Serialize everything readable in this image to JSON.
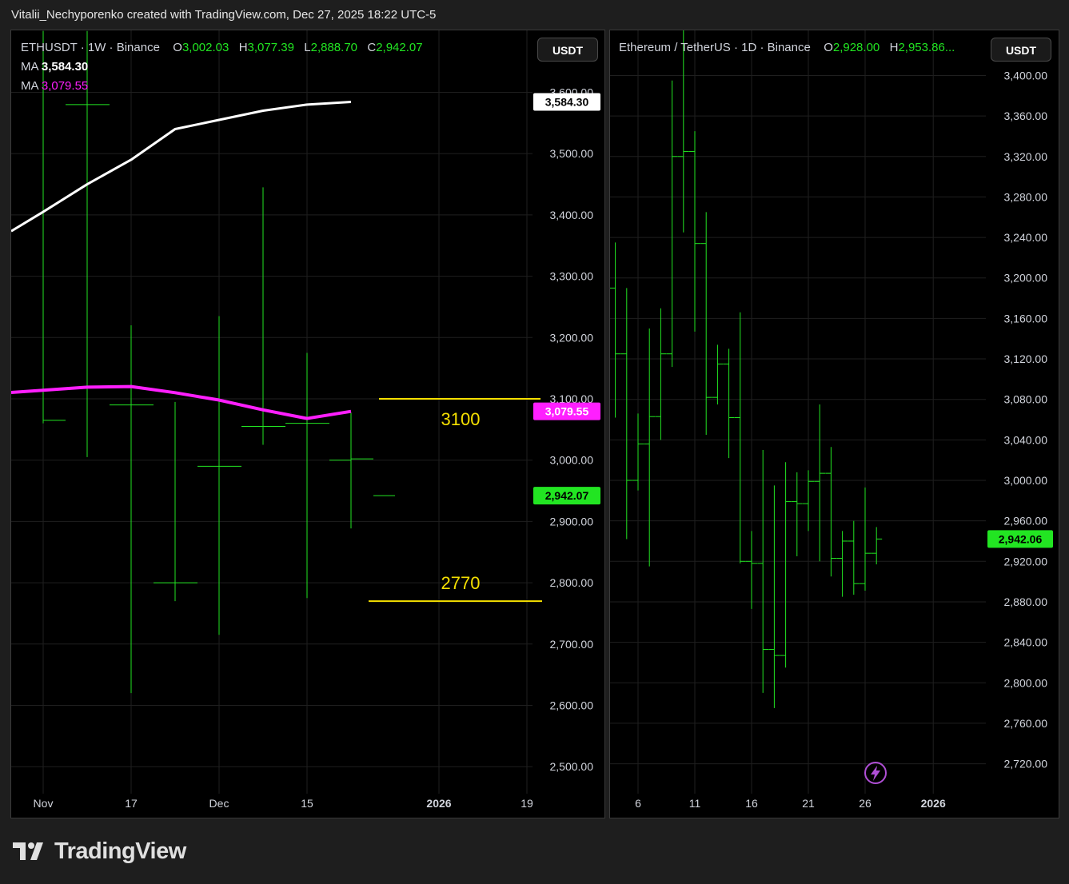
{
  "header": {
    "attribution": "Vitalii_Nechyporenko created with TradingView.com, Dec 27, 2025 18:22 UTC-5"
  },
  "brand": {
    "logo_icon": "tradingview-logo-icon",
    "name": "TradingView"
  },
  "colors": {
    "up": "#22e522",
    "ma_long": "#ffffff",
    "ma_short": "#ff1fff",
    "level": "#f5e000",
    "grid": "#1f1f1f",
    "axis_text": "#d1d4dc"
  },
  "left_panel": {
    "legend": {
      "symbol": "ETHUSDT · 1W · Binance",
      "o_label": "O",
      "o_value": "3,002.03",
      "h_label": "H",
      "h_value": "3,077.39",
      "l_label": "L",
      "l_value": "2,888.70",
      "c_label": "C",
      "c_value": "2,942.07",
      "ma1_label": "MA",
      "ma1_value": "3,584.30",
      "ma2_label": "MA",
      "ma2_value": "3,079.55"
    },
    "unit_button": "USDT",
    "annotations": {
      "level_high_text": "3100",
      "level_low_text": "2770"
    },
    "price_tags": {
      "ma1": "3,584.30",
      "ma2": "3,079.55",
      "last": "2,942.07"
    }
  },
  "right_panel": {
    "legend": {
      "symbol": "Ethereum / TetherUS · 1D · Binance",
      "o_label": "O",
      "o_value": "2,928.00",
      "h_label": "H",
      "h_value": "2,953.86..."
    },
    "unit_button": "USDT",
    "price_tag": "2,942.06",
    "bottom_icon": "lightning-icon"
  },
  "chart_data": [
    {
      "type": "ohlc",
      "title": "ETHUSDT · 1W · Binance",
      "x_tick_labels": [
        "Nov",
        "17",
        "Dec",
        "15",
        "2026",
        "19"
      ],
      "y_tick_labels": [
        "3,600.00",
        "3,500.00",
        "3,400.00",
        "3,300.00",
        "3,200.00",
        "3,100.00",
        "3,000.00",
        "2,900.00",
        "2,800.00",
        "2,700.00",
        "2,600.00",
        "2,500.00"
      ],
      "ylim": [
        2460,
        3700
      ],
      "grid": true,
      "bars": [
        {
          "date": "2025-11-03",
          "o": 3065,
          "h": 3700,
          "l": 3060,
          "c": 3580
        },
        {
          "date": "2025-11-10",
          "o": 3580,
          "h": 3700,
          "l": 3005,
          "c": 3090
        },
        {
          "date": "2025-11-17",
          "o": 3090,
          "h": 3220,
          "l": 2620,
          "c": 2800
        },
        {
          "date": "2025-11-24",
          "o": 2800,
          "h": 3095,
          "l": 2770,
          "c": 2990
        },
        {
          "date": "2025-12-01",
          "o": 2990,
          "h": 3235,
          "l": 2715,
          "c": 3055
        },
        {
          "date": "2025-12-08",
          "o": 3055,
          "h": 3445,
          "l": 3025,
          "c": 3060
        },
        {
          "date": "2025-12-15",
          "o": 3060,
          "h": 3175,
          "l": 2775,
          "c": 3000
        },
        {
          "date": "2025-12-22",
          "o": 3002.03,
          "h": 3077.39,
          "l": 2888.7,
          "c": 2942.07
        }
      ],
      "series": [
        {
          "name": "MA",
          "color": "#ffffff",
          "values": [
            3405,
            3450,
            3490,
            3540,
            3555,
            3570,
            3580,
            3584.3
          ]
        },
        {
          "name": "MA",
          "color": "#ff1fff",
          "values": [
            3114,
            3119,
            3120,
            3110,
            3098,
            3082,
            3068,
            3079.55
          ]
        }
      ],
      "horizontal_levels": [
        {
          "value": 3100,
          "label": "3100",
          "color": "#f5e000"
        },
        {
          "value": 2770,
          "label": "2770",
          "color": "#f5e000"
        }
      ]
    },
    {
      "type": "ohlc",
      "title": "Ethereum / TetherUS · 1D · Binance",
      "x_tick_labels": [
        "6",
        "11",
        "16",
        "21",
        "26",
        "2026"
      ],
      "y_tick_labels": [
        "3,400.00",
        "3,360.00",
        "3,320.00",
        "3,280.00",
        "3,240.00",
        "3,200.00",
        "3,160.00",
        "3,120.00",
        "3,080.00",
        "3,040.00",
        "3,000.00",
        "2,960.00",
        "2,920.00",
        "2,880.00",
        "2,840.00",
        "2,800.00",
        "2,760.00",
        "2,720.00"
      ],
      "ylim": [
        2700,
        3420
      ],
      "grid": true,
      "bars": [
        {
          "day": 4,
          "o": 3190,
          "h": 3235,
          "l": 3062,
          "c": 3125
        },
        {
          "day": 5,
          "o": 3125,
          "h": 3190,
          "l": 2942,
          "c": 3000
        },
        {
          "day": 6,
          "o": 3000,
          "h": 3066,
          "l": 2990,
          "c": 3036
        },
        {
          "day": 7,
          "o": 3036,
          "h": 3150,
          "l": 2915,
          "c": 3063
        },
        {
          "day": 8,
          "o": 3063,
          "h": 3170,
          "l": 3040,
          "c": 3125
        },
        {
          "day": 9,
          "o": 3125,
          "h": 3395,
          "l": 3112,
          "c": 3320
        },
        {
          "day": 10,
          "o": 3320,
          "h": 3470,
          "l": 3245,
          "c": 3325
        },
        {
          "day": 11,
          "o": 3325,
          "h": 3345,
          "l": 3147,
          "c": 3234
        },
        {
          "day": 12,
          "o": 3234,
          "h": 3265,
          "l": 3045,
          "c": 3082
        },
        {
          "day": 13,
          "o": 3082,
          "h": 3134,
          "l": 3075,
          "c": 3115
        },
        {
          "day": 14,
          "o": 3115,
          "h": 3130,
          "l": 3022,
          "c": 3062
        },
        {
          "day": 15,
          "o": 3062,
          "h": 3166,
          "l": 2918,
          "c": 2920
        },
        {
          "day": 16,
          "o": 2920,
          "h": 2950,
          "l": 2873,
          "c": 2918
        },
        {
          "day": 17,
          "o": 2918,
          "h": 3030,
          "l": 2790,
          "c": 2833
        },
        {
          "day": 18,
          "o": 2833,
          "h": 2995,
          "l": 2775,
          "c": 2827
        },
        {
          "day": 19,
          "o": 2827,
          "h": 3018,
          "l": 2815,
          "c": 2979
        },
        {
          "day": 20,
          "o": 2979,
          "h": 3008,
          "l": 2925,
          "c": 2977
        },
        {
          "day": 21,
          "o": 2977,
          "h": 3010,
          "l": 2950,
          "c": 2999
        },
        {
          "day": 22,
          "o": 2999,
          "h": 3075,
          "l": 2920,
          "c": 3007
        },
        {
          "day": 23,
          "o": 3007,
          "h": 3033,
          "l": 2905,
          "c": 2923
        },
        {
          "day": 24,
          "o": 2923,
          "h": 2950,
          "l": 2885,
          "c": 2940
        },
        {
          "day": 25,
          "o": 2940,
          "h": 2960,
          "l": 2887,
          "c": 2898
        },
        {
          "day": 26,
          "o": 2898,
          "h": 2993,
          "l": 2891,
          "c": 2928
        },
        {
          "day": 27,
          "o": 2928.0,
          "h": 2953.86,
          "l": 2917,
          "c": 2942.06
        }
      ]
    }
  ]
}
